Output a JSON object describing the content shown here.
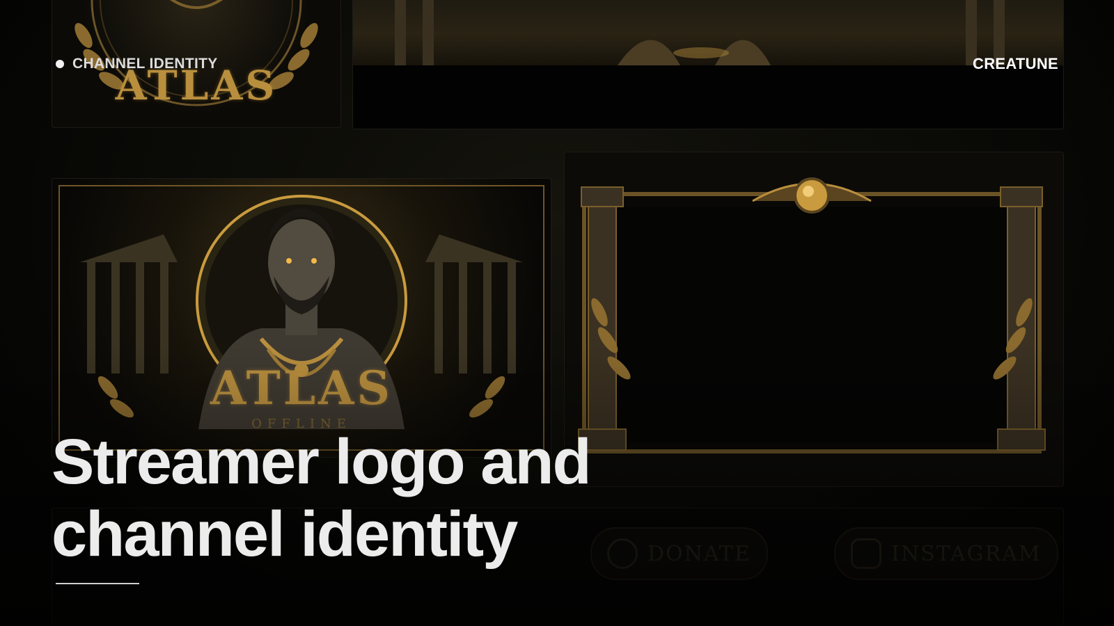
{
  "header": {
    "section_label": "CHANNEL IDENTITY",
    "brand": "CREATUNE"
  },
  "hero": {
    "headline_line1": "Streamer logo and",
    "headline_line2": "channel identity"
  },
  "artwork": {
    "logo_card_text": "ATLAS",
    "offline_title": "ATLAS",
    "offline_subtitle": "OFFLINE",
    "buttons": [
      {
        "label": "DONATE",
        "icon": "donate-icon"
      },
      {
        "label": "INSTAGRAM",
        "icon": "instagram-icon"
      }
    ]
  },
  "colors": {
    "background": "#000000",
    "gold": "#b98f3e",
    "text_primary": "#ececec",
    "text_secondary": "#dcdcdc"
  }
}
